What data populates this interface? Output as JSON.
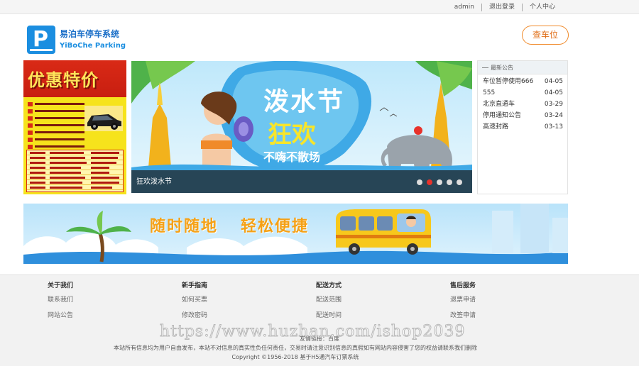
{
  "topbar": {
    "links": [
      "admin",
      "退出登录",
      "个人中心"
    ]
  },
  "logo": {
    "letter": "P",
    "name_cn": "易泊车停车系统",
    "name_en": "YiBoChe Parking",
    "brand_color": "#1b8ee0"
  },
  "header": {
    "find_button": "查车位",
    "accent_color": "#f08a2a"
  },
  "promo": {
    "title": "优惠特价"
  },
  "banner": {
    "headline_1": "泼水节",
    "headline_2": "狂欢",
    "headline_3": "不嗨不散场",
    "caption": "狂欢泼水节",
    "slides": 5,
    "active_slide": 2
  },
  "notice": {
    "title": "最新公告",
    "items": [
      {
        "text": "车位暂停使用666",
        "date": "04-05"
      },
      {
        "text": "555",
        "date": "04-05"
      },
      {
        "text": "北京直通车",
        "date": "03-29"
      },
      {
        "text": "停用通知公告",
        "date": "03-24"
      },
      {
        "text": "高速封路",
        "date": "03-13"
      }
    ]
  },
  "wide_banner": {
    "slogan_1": "随时随地",
    "slogan_2": "轻松便捷"
  },
  "footer": {
    "columns": [
      {
        "title": "关于我们",
        "links": [
          "联系我们",
          "网站公告"
        ]
      },
      {
        "title": "新手指南",
        "links": [
          "如何买票",
          "修改密码"
        ]
      },
      {
        "title": "配送方式",
        "links": [
          "配送范围",
          "配送时间"
        ]
      },
      {
        "title": "售后服务",
        "links": [
          "退票申请",
          "改签申请"
        ]
      }
    ],
    "friend_links": "友情链接：百度",
    "disclaimer": "本站所有信息均为用户自由发布，本站不对信息的真实性负任何责任，交易时请注意识别信息的真假如有网站内容侵害了您的权益请联系我们删除",
    "copyright": "Copyright ©1956-2018 基于H5通汽车订票系统"
  },
  "watermark": "https://www.huzhan.com/ishop2039"
}
